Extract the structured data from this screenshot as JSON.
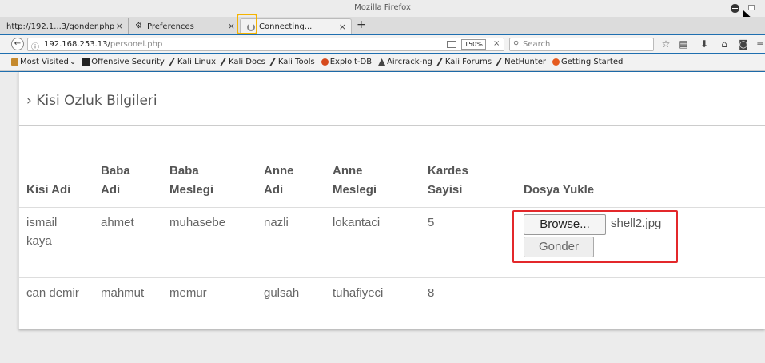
{
  "window": {
    "title": "Mozilla Firefox"
  },
  "tabs": [
    {
      "label": "http://192.1...3/gonder.php"
    },
    {
      "label": "Preferences"
    },
    {
      "label": "Connecting..."
    }
  ],
  "navbar": {
    "url_host": "192.168.253.13/",
    "url_path": "personel.php",
    "zoom": "150%",
    "search_placeholder": "Search"
  },
  "bookmarks": [
    {
      "label": "Most Visited",
      "icon": "folder-icon"
    },
    {
      "label": "Offensive Security",
      "icon": "offsec-icon"
    },
    {
      "label": "Kali Linux",
      "icon": "kali-dragon-icon"
    },
    {
      "label": "Kali Docs",
      "icon": "kali-dragon-icon"
    },
    {
      "label": "Kali Tools",
      "icon": "kali-dragon-icon"
    },
    {
      "label": "Exploit-DB",
      "icon": "exploit-db-icon"
    },
    {
      "label": "Aircrack-ng",
      "icon": "aircrack-icon"
    },
    {
      "label": "Kali Forums",
      "icon": "kali-dragon-icon"
    },
    {
      "label": "NetHunter",
      "icon": "kali-dragon-icon"
    },
    {
      "label": "Getting Started",
      "icon": "firefox-icon"
    }
  ],
  "page": {
    "title_chevron": "›",
    "title": "Kisi Ozluk Bilgileri"
  },
  "table": {
    "headers": [
      {
        "line1": "",
        "line2": "Kisi Adi"
      },
      {
        "line1": "Baba",
        "line2": "Adi"
      },
      {
        "line1": "Baba",
        "line2": "Meslegi"
      },
      {
        "line1": "Anne",
        "line2": "Adi"
      },
      {
        "line1": "Anne",
        "line2": "Meslegi"
      },
      {
        "line1": "Kardes",
        "line2": "Sayisi"
      },
      {
        "line1": "",
        "line2": "Dosya Yukle"
      }
    ],
    "rows": [
      {
        "kisi_line1": "ismail",
        "kisi_line2": "kaya",
        "baba_adi": "ahmet",
        "baba_meslegi": "muhasebe",
        "anne_adi": "nazli",
        "anne_meslegi": "lokantaci",
        "kardes": "5"
      },
      {
        "kisi_line1": "can demir",
        "kisi_line2": "",
        "baba_adi": "mahmut",
        "baba_meslegi": "memur",
        "anne_adi": "gulsah",
        "anne_meslegi": "tuhafiyeci",
        "kardes": "8"
      }
    ],
    "upload": {
      "browse_label": "Browse...",
      "selected_file": "shell2.jpg",
      "submit_label": "Gonder"
    }
  },
  "colors": {
    "upload_highlight": "#e3282b",
    "tab_highlight": "#f5b300"
  }
}
